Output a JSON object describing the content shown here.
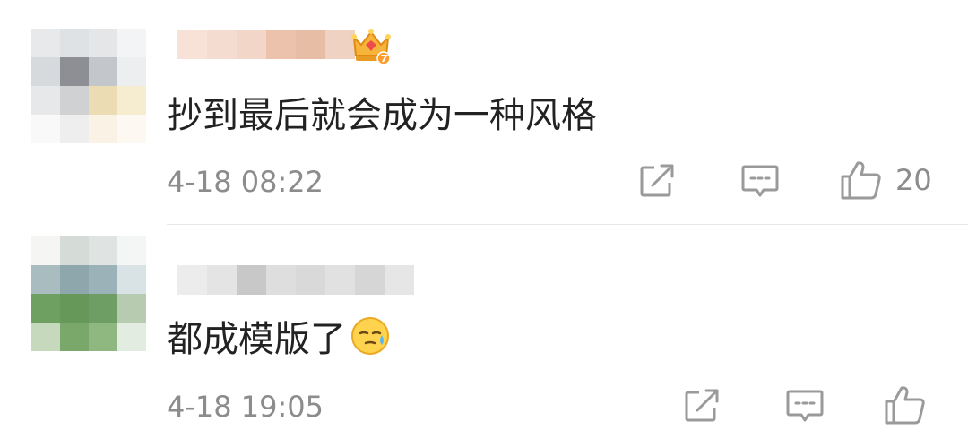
{
  "comments": [
    {
      "text": "抄到最后就会成为一种风格",
      "timestamp": "4-18 08:22",
      "like_count": "20",
      "badge_icon": "crown-icon",
      "actions": [
        "repost-icon",
        "comment-icon",
        "like-icon"
      ]
    },
    {
      "text": "都成模版了",
      "emoji_icon": "sweat-emoji-icon",
      "timestamp": "4-18 19:05",
      "like_count": "",
      "actions": [
        "repost-icon",
        "comment-icon",
        "like-icon"
      ]
    }
  ],
  "colors": {
    "primary_text": "#222222",
    "secondary_text": "#8c8c8c",
    "icon": "#9a9a9a",
    "divider": "#e8e8e8"
  }
}
